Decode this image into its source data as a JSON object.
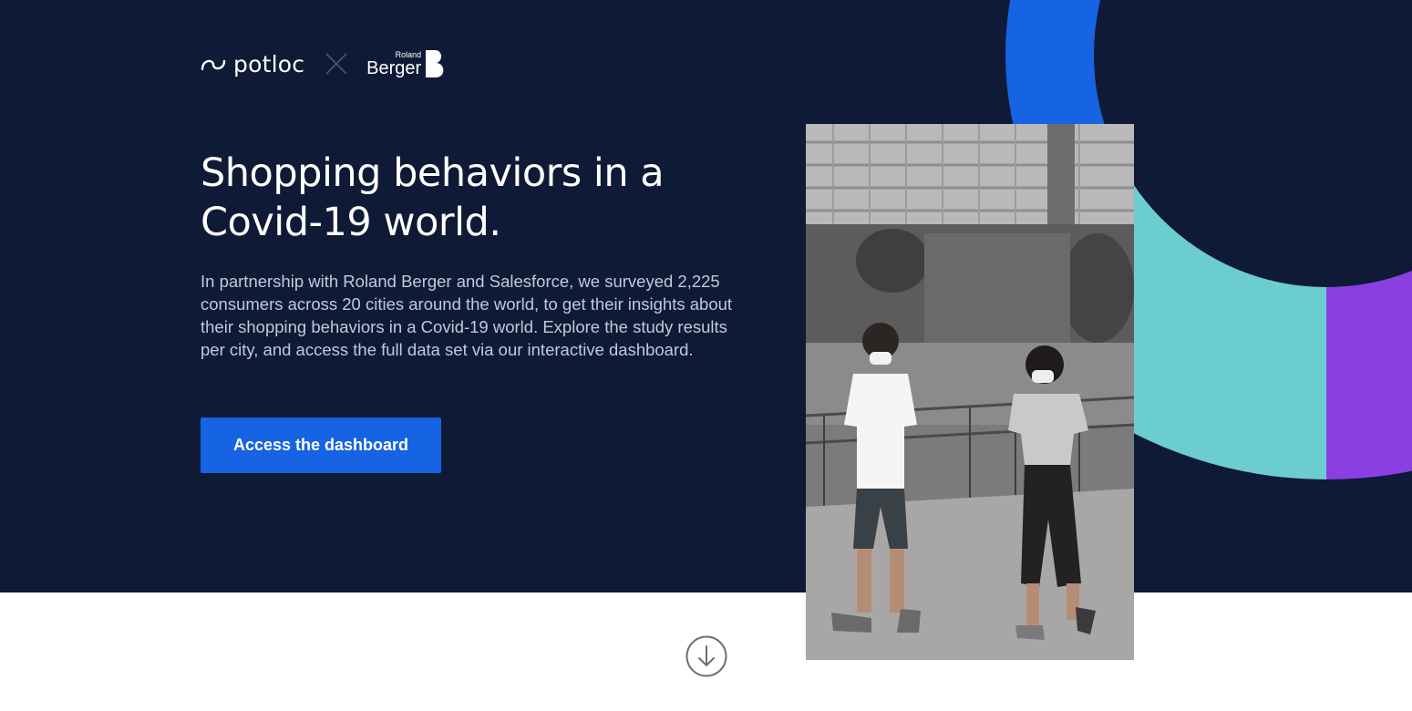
{
  "header": {
    "logo_potloc": "potloc",
    "logo_partner_small": "Roland",
    "logo_partner_big": "Berger",
    "logo_partner_letter": "B"
  },
  "hero": {
    "title": "Shopping behaviors in a Covid-19 world.",
    "intro": "In partnership with Roland Berger and Salesforce, we surveyed 2,225 consumers across 20 cities around the world, to get their insights about their shopping behaviors in a Covid-19 world. Explore the study results per city, and access the full data set via our interactive dashboard.",
    "cta_label": "Access the dashboard"
  },
  "icons": {
    "partner_separator": "close-x-icon",
    "scroll": "arrow-down-circle-icon"
  },
  "colors": {
    "hero_bg": "#0f1a36",
    "accent_blue": "#1663e3",
    "ring_teal": "#6ccdd0",
    "ring_purple": "#8a3fe3",
    "intro_text": "#c3c9d9"
  }
}
